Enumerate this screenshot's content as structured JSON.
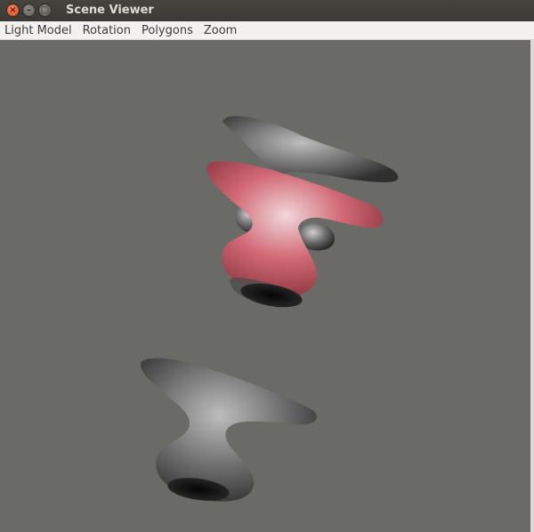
{
  "window": {
    "title": "Scene Viewer",
    "buttons": {
      "close": "×",
      "minimize": "–",
      "maximize": "□"
    }
  },
  "menu": {
    "items": [
      "Light Model",
      "Rotation",
      "Polygons",
      "Zoom"
    ]
  },
  "viewport": {
    "background": "#6a6a66",
    "objects": [
      {
        "name": "shape-top-grey",
        "color": "#6f6f6f"
      },
      {
        "name": "shape-middle-pink",
        "color": "#c25a66"
      },
      {
        "name": "shape-bottom-grey",
        "color": "#6f6f6f"
      }
    ]
  }
}
